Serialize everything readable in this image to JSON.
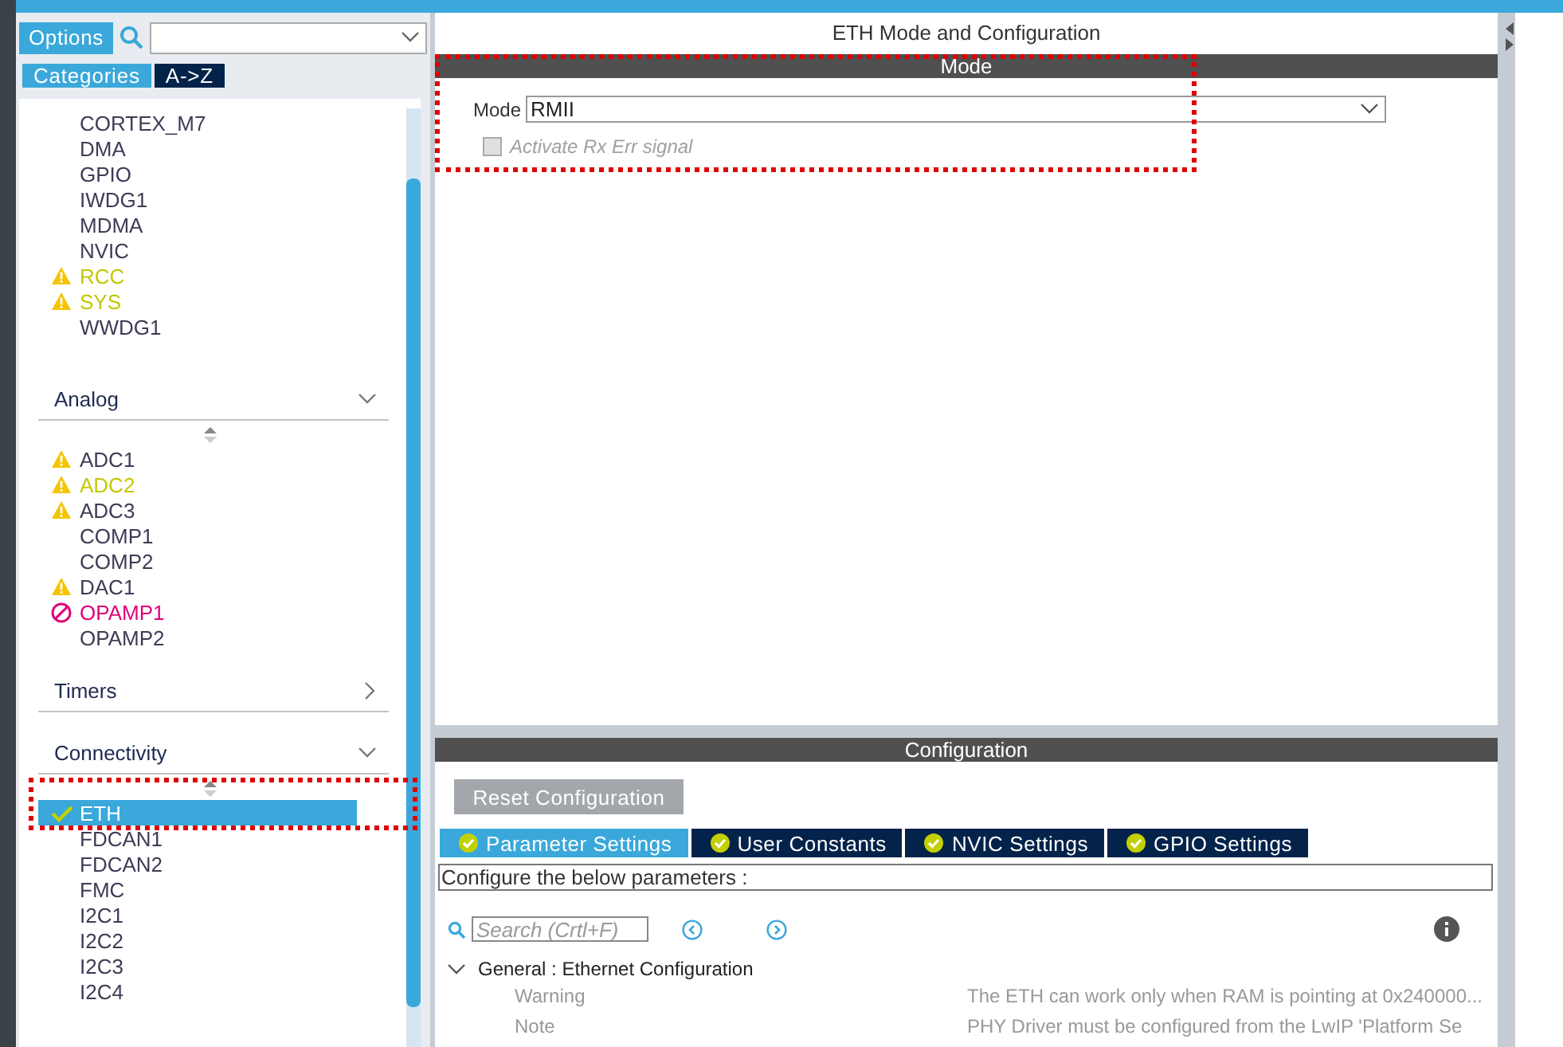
{
  "toolbar": {
    "options_button": "Options"
  },
  "view_tabs": [
    {
      "label": "Categories",
      "selected": true
    },
    {
      "label": "A->Z",
      "selected": false
    }
  ],
  "system_items": [
    {
      "name": "CORTEX_M7",
      "kind": "plain",
      "color": "#3c3c55",
      "selected": false
    },
    {
      "name": "DMA",
      "kind": "plain",
      "color": "#3c3c55",
      "selected": false
    },
    {
      "name": "GPIO",
      "kind": "plain",
      "color": "#3c3c55",
      "selected": false
    },
    {
      "name": "IWDG1",
      "kind": "plain",
      "color": "#3c3c55",
      "selected": false
    },
    {
      "name": "MDMA",
      "kind": "plain",
      "color": "#3c3c55",
      "selected": false
    },
    {
      "name": "NVIC",
      "kind": "plain",
      "color": "#3c3c55",
      "selected": false
    },
    {
      "name": "RCC",
      "kind": "warning",
      "color": "#c3c800",
      "selected": false
    },
    {
      "name": "SYS",
      "kind": "warning",
      "color": "#c3c800",
      "selected": false
    },
    {
      "name": "WWDG1",
      "kind": "plain",
      "color": "#3c3c55",
      "selected": false
    }
  ],
  "categories": [
    {
      "name": "Analog",
      "expanded": true,
      "highlighted": false,
      "items": [
        {
          "name": "ADC1",
          "kind": "warning",
          "color": "#3c3c55",
          "selected": false
        },
        {
          "name": "ADC2",
          "kind": "warning",
          "color": "#c3c800",
          "selected": false
        },
        {
          "name": "ADC3",
          "kind": "warning",
          "color": "#3c3c55",
          "selected": false
        },
        {
          "name": "COMP1",
          "kind": "plain",
          "color": "#3c3c55",
          "selected": false
        },
        {
          "name": "COMP2",
          "kind": "plain",
          "color": "#3c3c55",
          "selected": false
        },
        {
          "name": "DAC1",
          "kind": "warning",
          "color": "#3c3c55",
          "selected": false
        },
        {
          "name": "OPAMP1",
          "kind": "error",
          "color": "#e0007a",
          "selected": false
        },
        {
          "name": "OPAMP2",
          "kind": "plain",
          "color": "#3c3c55",
          "selected": false
        }
      ]
    },
    {
      "name": "Timers",
      "expanded": false,
      "highlighted": false
    },
    {
      "name": "Connectivity",
      "expanded": true,
      "highlighted": true,
      "items": [
        {
          "name": "ETH",
          "kind": "ok",
          "selected": true
        },
        {
          "name": "FDCAN1",
          "kind": "plain",
          "color": "#3c3c55",
          "selected": false
        },
        {
          "name": "FDCAN2",
          "kind": "plain",
          "color": "#3c3c55",
          "selected": false
        },
        {
          "name": "FMC",
          "kind": "plain",
          "color": "#3c3c55",
          "selected": false
        },
        {
          "name": "I2C1",
          "kind": "plain",
          "color": "#3c3c55",
          "selected": false
        },
        {
          "name": "I2C2",
          "kind": "plain",
          "color": "#3c3c55",
          "selected": false
        },
        {
          "name": "I2C3",
          "kind": "plain",
          "color": "#3c3c55",
          "selected": false
        },
        {
          "name": "I2C4",
          "kind": "plain",
          "color": "#3c3c55",
          "selected": false
        }
      ]
    }
  ],
  "title": "ETH Mode and Configuration",
  "mode_section": {
    "header": "Mode",
    "highlighted": true,
    "mode_label": "Mode",
    "mode_value": "RMII",
    "checkbox": {
      "label": "Activate Rx Err signal",
      "checked": false,
      "disabled": true
    }
  },
  "config_section": {
    "header": "Configuration",
    "reset_button": "Reset Configuration",
    "tabs": [
      {
        "label": "Parameter Settings",
        "selected": true
      },
      {
        "label": "User Constants",
        "selected": false
      },
      {
        "label": "NVIC Settings",
        "selected": false
      },
      {
        "label": "GPIO Settings",
        "selected": false
      }
    ],
    "hint": "Configure the below parameters :",
    "search_placeholder": "Search (Crtl+F)",
    "group": {
      "title": "General : Ethernet Configuration",
      "expanded": true,
      "rows": [
        {
          "name": "Warning",
          "value": "The ETH can work only when RAM is pointing at 0x240000..."
        },
        {
          "name": "Note",
          "value": "PHY Driver must be configured from the LwIP 'Platform Se"
        }
      ]
    }
  }
}
